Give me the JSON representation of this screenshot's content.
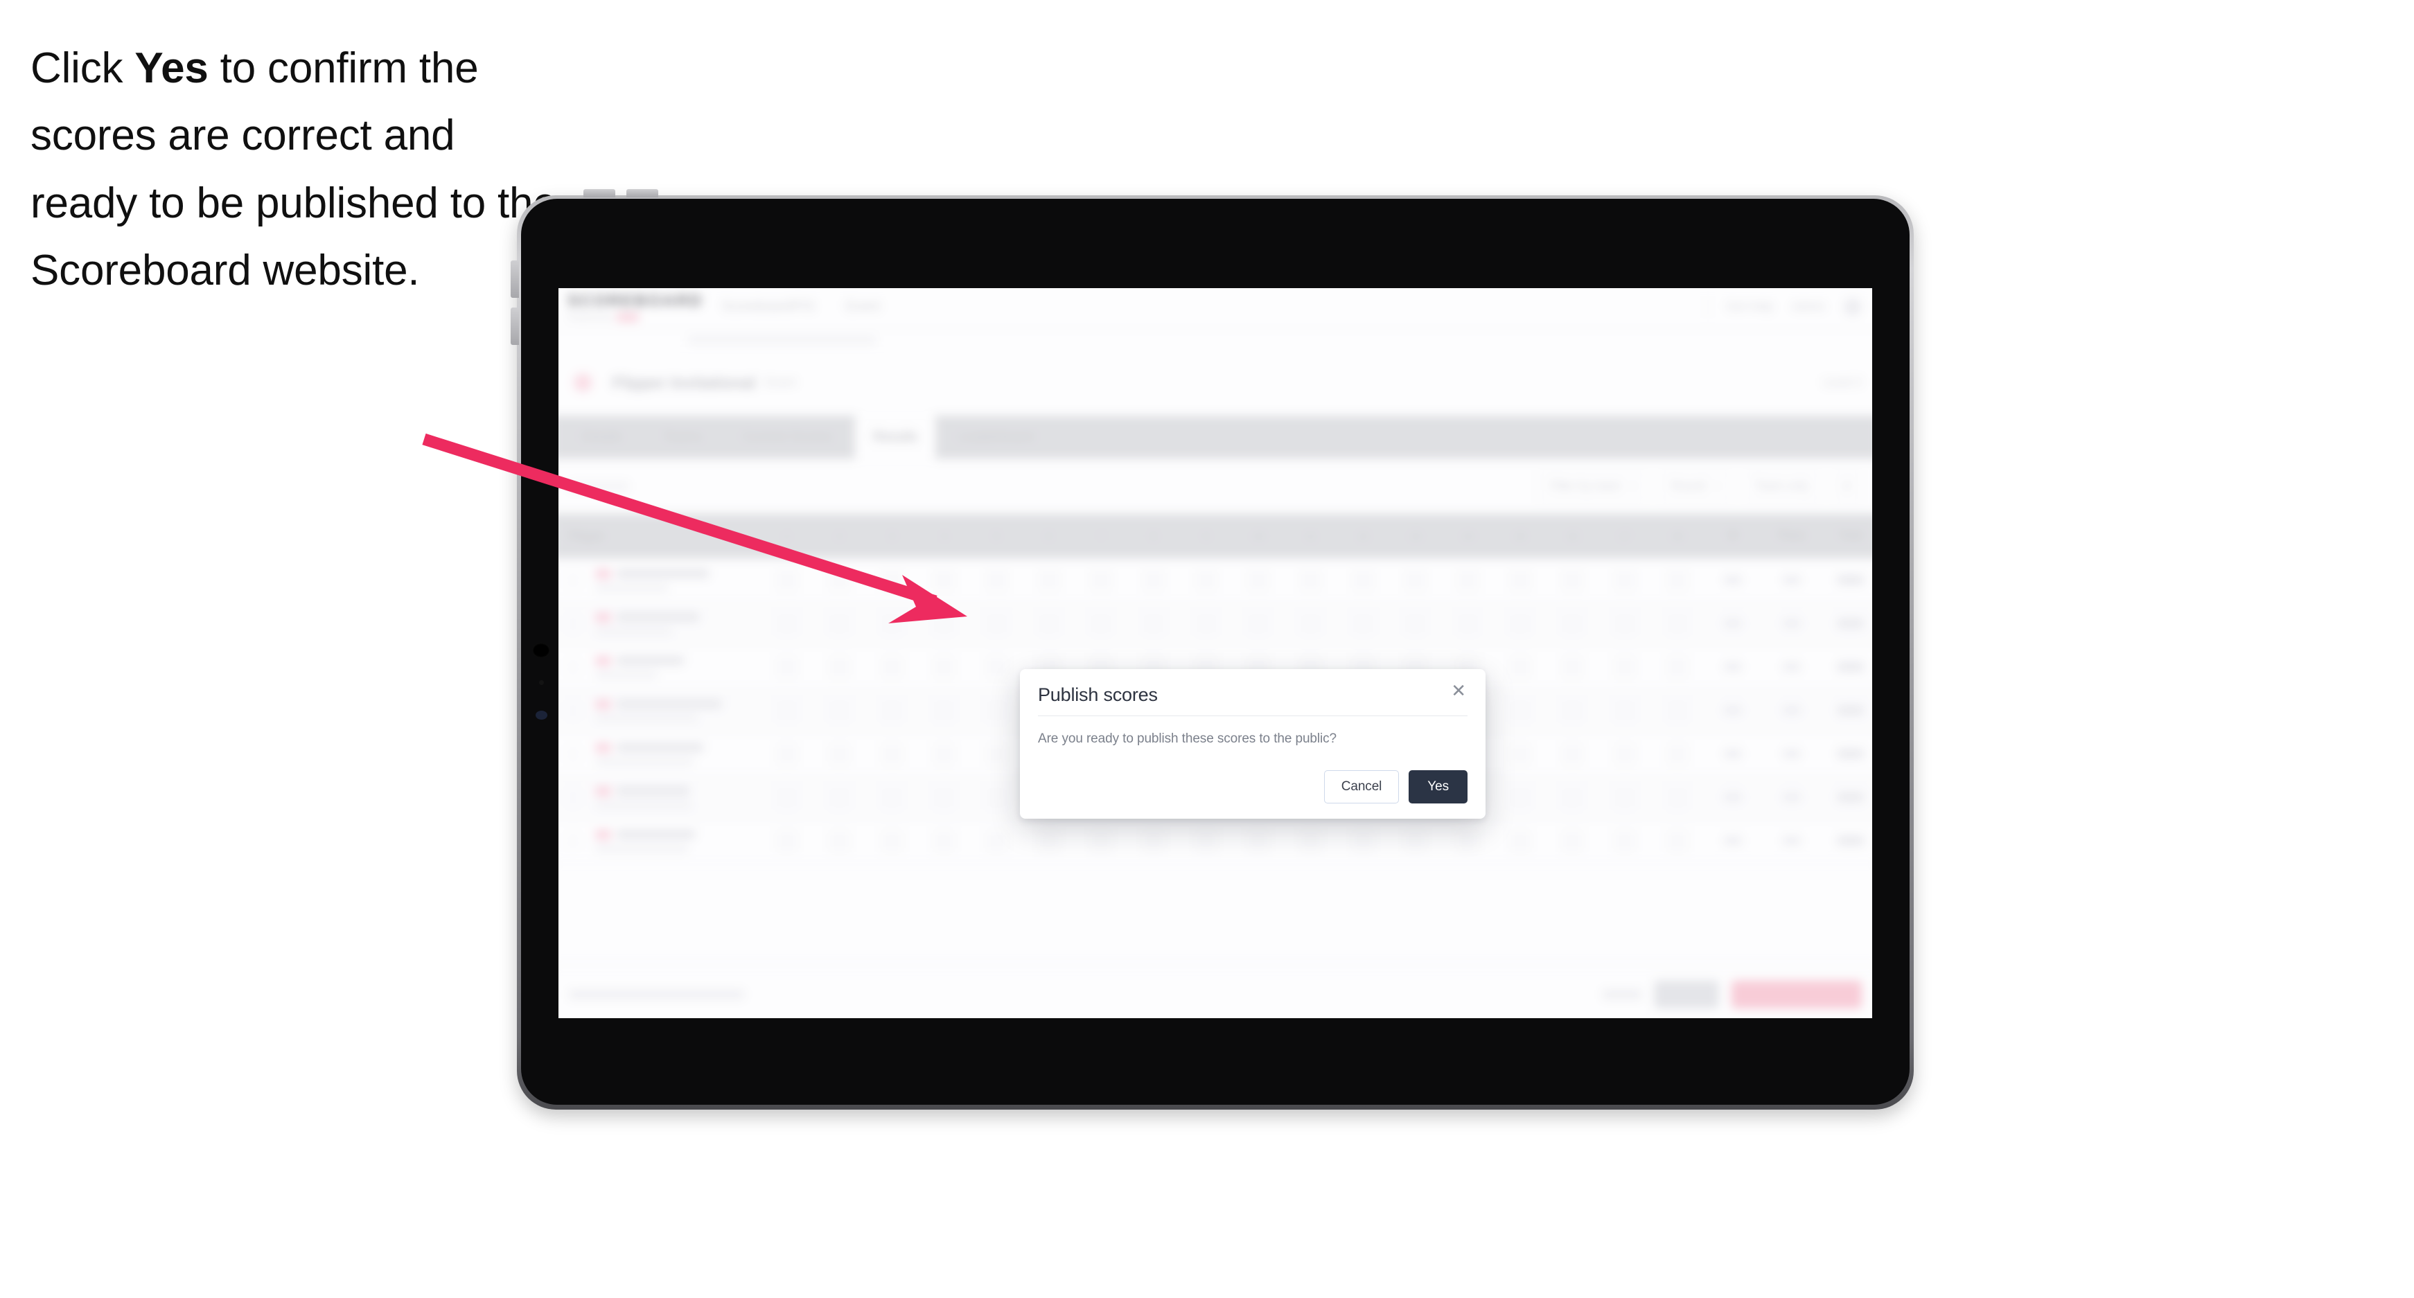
{
  "caption": {
    "before": "Click ",
    "emphasis": "Yes",
    "after": " to confirm the scores are correct and ready to be published to the Scoreboard website."
  },
  "colors": {
    "arrow": "#ED2B5F",
    "primary_button": "#2B3445",
    "cancel_border": "#CFD9EA",
    "device_bezel": "#0B0B0C",
    "tabbar": "#D5D6D9"
  },
  "modal": {
    "title": "Publish scores",
    "message": "Are you ready to publish these scores to the public?",
    "close_icon": "✕",
    "cancel_label": "Cancel",
    "confirm_label": "Yes"
  },
  "app": {
    "brand": "SCOREBOARD",
    "brand_tagline": "Powered by",
    "topnav": [
      "Scoreboard/FIS",
      "Event"
    ],
    "topbar_right": [
      "Get Help",
      "Admin"
    ],
    "event_name": "Flipper Invitational",
    "event_sub": "Event",
    "event_right": "Level 3",
    "tabs": [
      {
        "label": "Details",
        "active": false
      },
      {
        "label": "Teams",
        "active": false
      },
      {
        "label": "Current Scores",
        "active": false
      },
      {
        "label": "Results",
        "active": true
      },
      {
        "label": "Leaderboard",
        "active": false
      }
    ],
    "filters": [
      {
        "label": "Filter by team",
        "type": "select"
      },
      {
        "label": "Round",
        "type": "select"
      },
      {
        "label": "Team only",
        "type": "select"
      }
    ],
    "table": {
      "columns": [
        "Player",
        "1",
        "2",
        "3",
        "4",
        "5",
        "6",
        "7",
        "8",
        "9",
        "10",
        "11",
        "12",
        "13",
        "14",
        "15",
        "16",
        "17",
        "18",
        "W",
        "Place",
        "Total"
      ],
      "row_count": 7
    },
    "bottom_bar": {
      "note": "Scores unconfirmed",
      "buttons": [
        "Cancel",
        "Save",
        "Confirm and publish"
      ]
    }
  }
}
